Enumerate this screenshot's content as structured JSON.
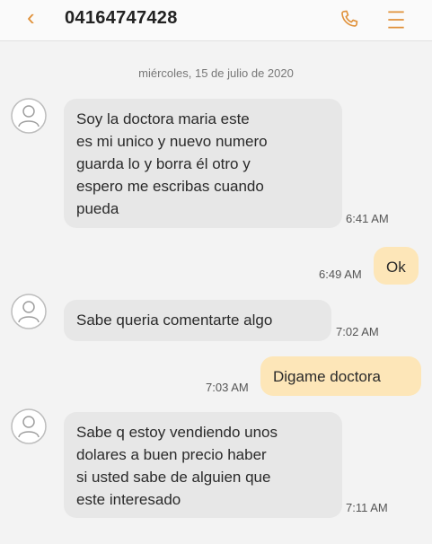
{
  "header": {
    "title": "04164747428",
    "back_icon": "chevron-left-icon",
    "phone_icon": "phone-icon",
    "menu_icon": "menu-icon",
    "accent": "#e0913a"
  },
  "date_separator": "miércoles, 15 de julio de 2020",
  "messages": [
    {
      "direction": "incoming",
      "text": "Soy la doctora maria este\nes mi unico y nuevo numero\nguarda lo y borra él otro y\nespero me escribas cuando\npueda",
      "time": "6:41 AM"
    },
    {
      "direction": "outgoing",
      "text": "Ok",
      "time": "6:49 AM"
    },
    {
      "direction": "incoming",
      "text": "Sabe queria comentarte algo",
      "time": "7:02 AM"
    },
    {
      "direction": "outgoing",
      "text": "Digame doctora",
      "time": "7:03 AM"
    },
    {
      "direction": "incoming",
      "text": "Sabe q estoy vendiendo unos\ndolares a buen precio haber\nsi usted sabe de alguien que\neste interesado",
      "time": "7:11 AM"
    }
  ],
  "colors": {
    "incoming_bubble": "#e7e7e7",
    "outgoing_bubble": "#fde6b8",
    "background": "#f3f3f3"
  }
}
